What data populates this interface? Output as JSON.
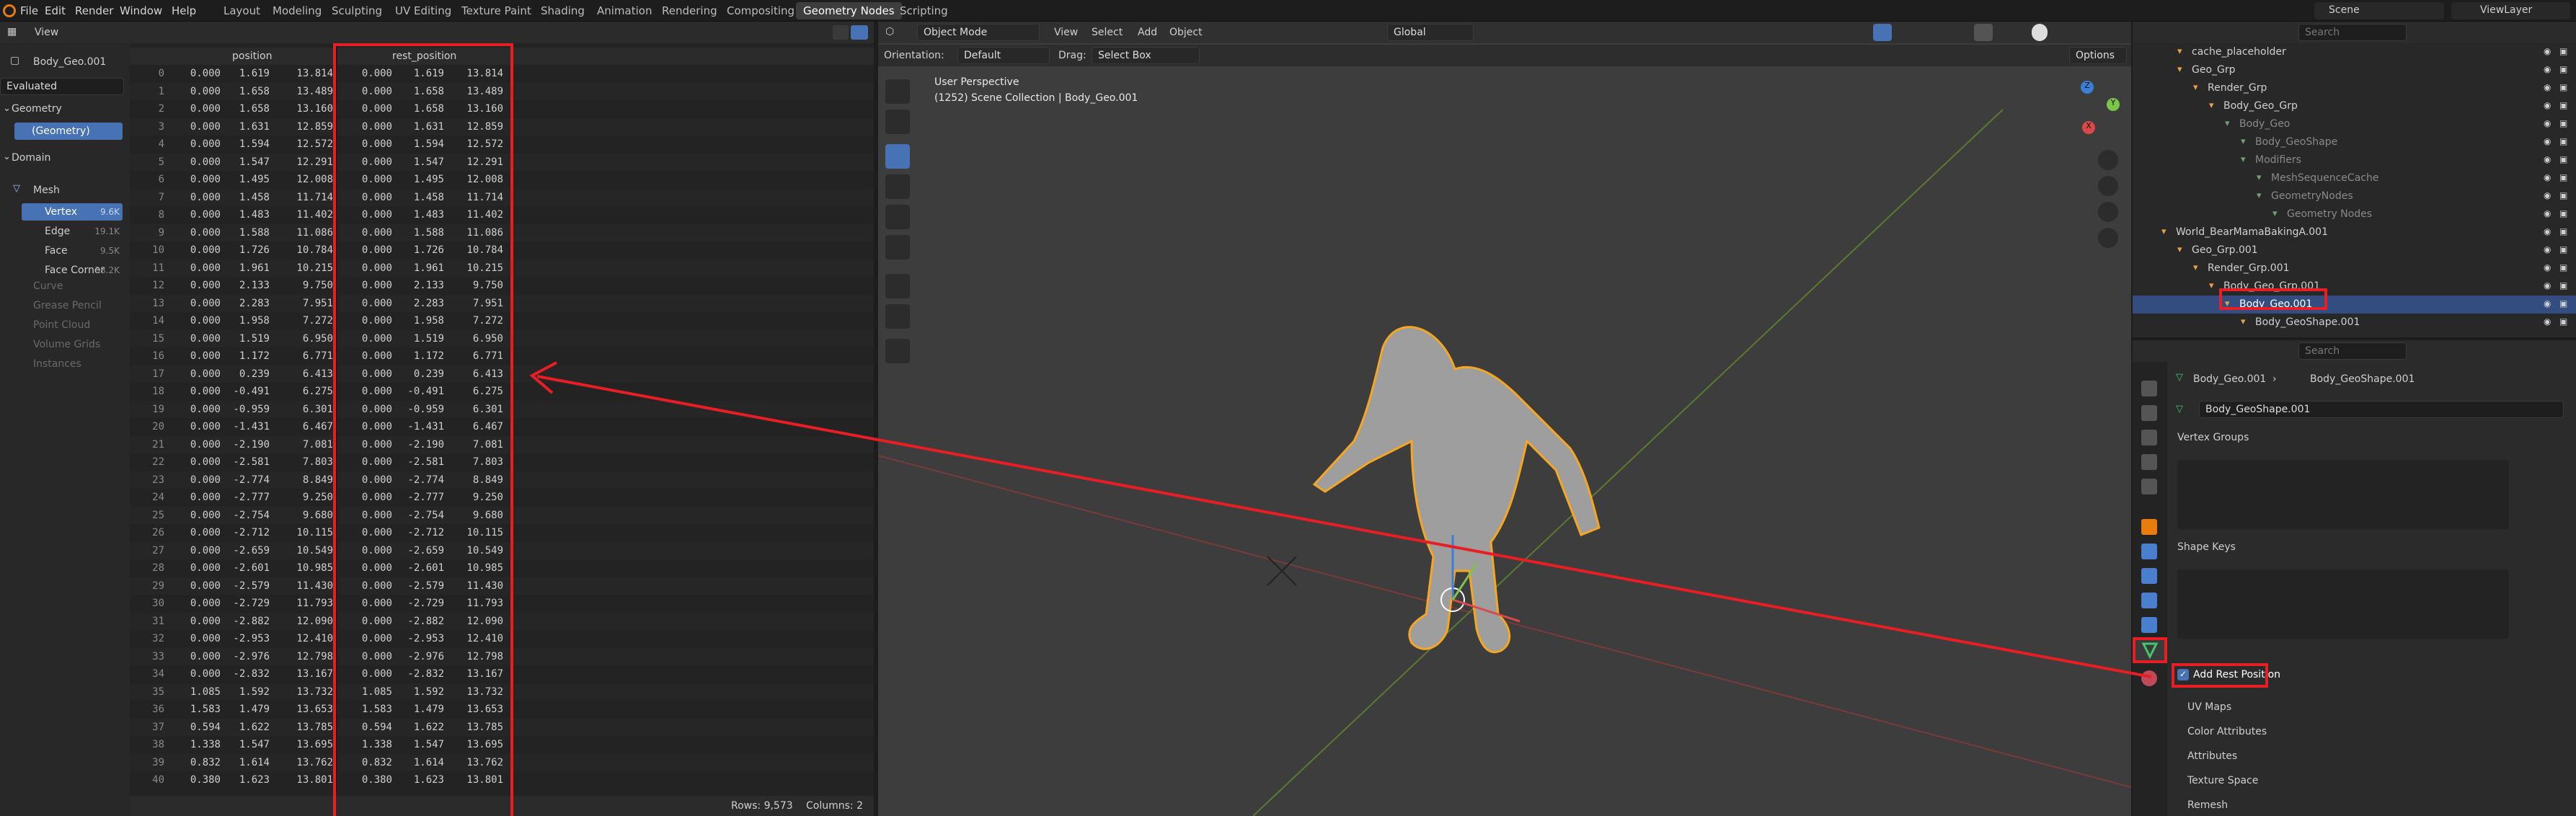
{
  "menu": [
    "File",
    "Edit",
    "Render",
    "Window",
    "Help"
  ],
  "workspaces": [
    "Layout",
    "Modeling",
    "Sculpting",
    "UV Editing",
    "Texture Paint",
    "Shading",
    "Animation",
    "Rendering",
    "Compositing",
    "Geometry Nodes",
    "Scripting"
  ],
  "active_workspace": "Geometry Nodes",
  "scene": "Scene",
  "view_layer": "ViewLayer",
  "spreadsheet": {
    "view_menu": "View",
    "object_name": "Body_Geo.001",
    "eval_mode": "Evaluated",
    "geometry_label": "Geometry",
    "geometry_item": "(Geometry)",
    "domain_label": "Domain",
    "mesh_label": "Mesh",
    "domains": [
      {
        "name": "Vertex",
        "count": "9.6K",
        "active": true
      },
      {
        "name": "Edge",
        "count": "19.1K",
        "active": false
      },
      {
        "name": "Face",
        "count": "9.5K",
        "active": false
      },
      {
        "name": "Face Corner",
        "count": "38.2K",
        "active": false
      }
    ],
    "other_components": [
      "Curve",
      "Grease Pencil",
      "Point Cloud",
      "Volume Grids",
      "Instances"
    ],
    "col_position": "position",
    "col_rest": "rest_position",
    "rows": [
      [
        0,
        "0.000",
        "1.619",
        "13.814"
      ],
      [
        1,
        "0.000",
        "1.658",
        "13.489"
      ],
      [
        2,
        "0.000",
        "1.658",
        "13.160"
      ],
      [
        3,
        "0.000",
        "1.631",
        "12.859"
      ],
      [
        4,
        "0.000",
        "1.594",
        "12.572"
      ],
      [
        5,
        "0.000",
        "1.547",
        "12.291"
      ],
      [
        6,
        "0.000",
        "1.495",
        "12.008"
      ],
      [
        7,
        "0.000",
        "1.458",
        "11.714"
      ],
      [
        8,
        "0.000",
        "1.483",
        "11.402"
      ],
      [
        9,
        "0.000",
        "1.588",
        "11.086"
      ],
      [
        10,
        "0.000",
        "1.726",
        "10.784"
      ],
      [
        11,
        "0.000",
        "1.961",
        "10.215"
      ],
      [
        12,
        "0.000",
        "2.133",
        "9.750"
      ],
      [
        13,
        "0.000",
        "2.283",
        "7.951"
      ],
      [
        14,
        "0.000",
        "1.958",
        "7.272"
      ],
      [
        15,
        "0.000",
        "1.519",
        "6.950"
      ],
      [
        16,
        "0.000",
        "1.172",
        "6.771"
      ],
      [
        17,
        "0.000",
        "0.239",
        "6.413"
      ],
      [
        18,
        "0.000",
        "-0.491",
        "6.275"
      ],
      [
        19,
        "0.000",
        "-0.959",
        "6.301"
      ],
      [
        20,
        "0.000",
        "-1.431",
        "6.467"
      ],
      [
        21,
        "0.000",
        "-2.190",
        "7.081"
      ],
      [
        22,
        "0.000",
        "-2.581",
        "7.803"
      ],
      [
        23,
        "0.000",
        "-2.774",
        "8.849"
      ],
      [
        24,
        "0.000",
        "-2.777",
        "9.250"
      ],
      [
        25,
        "0.000",
        "-2.754",
        "9.680"
      ],
      [
        26,
        "0.000",
        "-2.712",
        "10.115"
      ],
      [
        27,
        "0.000",
        "-2.659",
        "10.549"
      ],
      [
        28,
        "0.000",
        "-2.601",
        "10.985"
      ],
      [
        29,
        "0.000",
        "-2.579",
        "11.430"
      ],
      [
        30,
        "0.000",
        "-2.729",
        "11.793"
      ],
      [
        31,
        "0.000",
        "-2.882",
        "12.090"
      ],
      [
        32,
        "0.000",
        "-2.953",
        "12.410"
      ],
      [
        33,
        "0.000",
        "-2.976",
        "12.798"
      ],
      [
        34,
        "0.000",
        "-2.832",
        "13.167"
      ],
      [
        35,
        "1.085",
        "1.592",
        "13.732"
      ],
      [
        36,
        "1.583",
        "1.479",
        "13.653"
      ],
      [
        37,
        "0.594",
        "1.622",
        "13.785"
      ],
      [
        38,
        "1.338",
        "1.547",
        "13.695"
      ],
      [
        39,
        "0.832",
        "1.614",
        "13.762"
      ],
      [
        40,
        "0.380",
        "1.623",
        "13.801"
      ]
    ],
    "rows_status": "Rows: 9,573",
    "columns_status": "Columns: 2"
  },
  "viewport": {
    "mode": "Object Mode",
    "menus": [
      "View",
      "Select",
      "Add",
      "Object"
    ],
    "orientation_label": "Orientation:",
    "orientation_value": "Default",
    "drag_label": "Drag:",
    "drag_value": "Select Box",
    "transform_global": "Global",
    "options_label": "Options",
    "overlay_title": "User Perspective",
    "overlay_sub": "(1252) Scene Collection | Body_Geo.001",
    "axis_x": "X",
    "axis_y": "Y",
    "axis_z": "Z"
  },
  "outliner": {
    "search_placeholder": "Search",
    "items": [
      {
        "label": "cache_placeholder",
        "indent": 1,
        "dim": false,
        "sel": false
      },
      {
        "label": "Geo_Grp",
        "indent": 1,
        "dim": false,
        "sel": false
      },
      {
        "label": "Render_Grp",
        "indent": 2,
        "dim": false,
        "sel": false
      },
      {
        "label": "Body_Geo_Grp",
        "indent": 3,
        "dim": false,
        "sel": false
      },
      {
        "label": "Body_Geo",
        "indent": 4,
        "dim": true,
        "sel": false
      },
      {
        "label": "Body_GeoShape",
        "indent": 5,
        "dim": true,
        "sel": false
      },
      {
        "label": "Modifiers",
        "indent": 5,
        "dim": true,
        "sel": false
      },
      {
        "label": "MeshSequenceCache",
        "indent": 6,
        "dim": true,
        "sel": false
      },
      {
        "label": "GeometryNodes",
        "indent": 6,
        "dim": true,
        "sel": false
      },
      {
        "label": "Geometry Nodes",
        "indent": 7,
        "dim": true,
        "sel": false
      },
      {
        "label": "World_BearMamaBakingA.001",
        "indent": 0,
        "dim": false,
        "sel": false
      },
      {
        "label": "Geo_Grp.001",
        "indent": 1,
        "dim": false,
        "sel": false
      },
      {
        "label": "Render_Grp.001",
        "indent": 2,
        "dim": false,
        "sel": false
      },
      {
        "label": "Body_Geo_Grp.001",
        "indent": 3,
        "dim": false,
        "sel": false
      },
      {
        "label": "Body_Geo.001",
        "indent": 4,
        "dim": false,
        "sel": true
      },
      {
        "label": "Body_GeoShape.001",
        "indent": 5,
        "dim": false,
        "sel": false
      }
    ]
  },
  "properties": {
    "search_placeholder": "Search",
    "breadcrumb_obj": "Body_Geo.001",
    "breadcrumb_data": "Body_GeoShape.001",
    "data_name": "Body_GeoShape.001",
    "vertex_groups": "Vertex Groups",
    "shape_keys": "Shape Keys",
    "add_rest_position": "Add Rest Position",
    "sections": [
      "UV Maps",
      "Color Attributes",
      "Attributes",
      "Texture Space",
      "Remesh"
    ]
  },
  "colors": {
    "accent": "#4772b3",
    "highlight": "#e81e25",
    "selection_orange": "#f5a623"
  }
}
